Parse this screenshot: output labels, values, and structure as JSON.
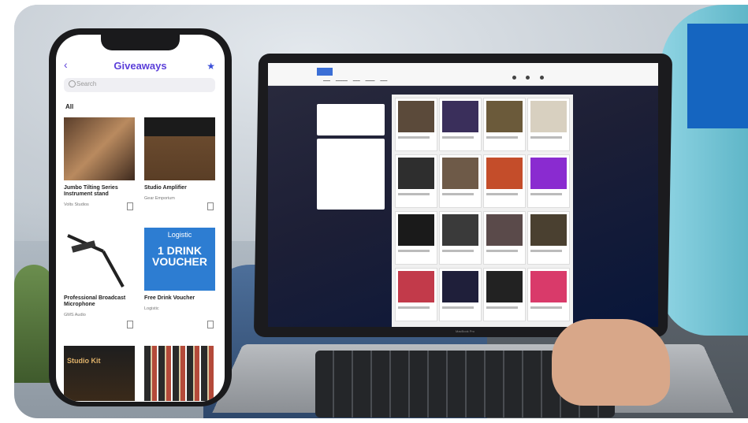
{
  "phone": {
    "title": "Giveaways",
    "search_placeholder": "Search",
    "section_label": "All",
    "cards": [
      {
        "title": "Jumbo Tilting Series Instrument stand",
        "sub": "Volts Studios"
      },
      {
        "title": "Studio Amplifier",
        "sub": "Gear Emporium"
      },
      {
        "title": "Professional Broadcast Microphone",
        "sub": "GMS Audio"
      },
      {
        "title": "Free Drink Voucher",
        "sub": "Logistic"
      }
    ],
    "voucher_brand": "Logistic",
    "voucher_line1": "1 DRINK",
    "voucher_line2": "VOUCHER",
    "ad_headline": "Studio Kit"
  },
  "laptop": {
    "brand": "MacBook Pro"
  },
  "colors": {
    "accent": "#5b3fd9",
    "voucher_blue": "#2d7dd2",
    "corner_blue": "#1565c0"
  }
}
